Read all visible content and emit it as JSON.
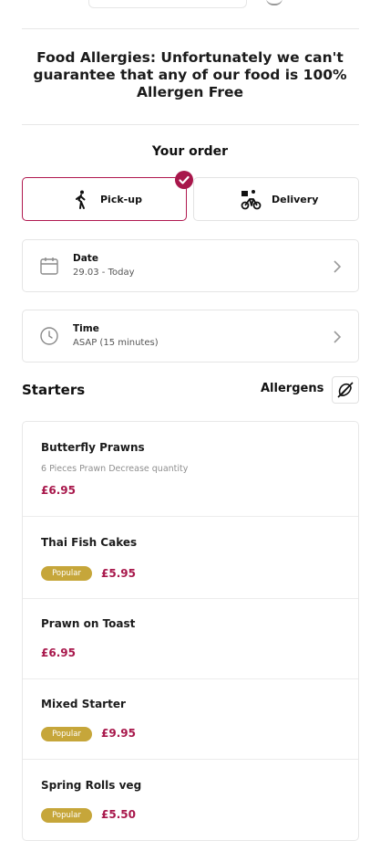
{
  "notice": {
    "allergy_text": "Food Allergies: Unfortunately we can't guarantee that any of our food is 100% Allergen Free"
  },
  "order": {
    "heading": "Your order",
    "options": [
      {
        "label": "Pick-up",
        "selected": true,
        "icon": "walking-person-icon"
      },
      {
        "label": "Delivery",
        "selected": false,
        "icon": "delivery-bike-icon"
      }
    ],
    "date": {
      "label": "Date",
      "value": "29.03 - Today",
      "icon": "calendar-icon"
    },
    "time": {
      "label": "Time",
      "value": "ASAP (15 minutes)",
      "icon": "clock-icon"
    }
  },
  "menu": {
    "section_title": "Starters",
    "allergens_label": "Allergens",
    "items": [
      {
        "name": "Butterfly Prawns",
        "description": "6 Pieces Prawn Decrease quantity",
        "price": "£6.95",
        "badge": ""
      },
      {
        "name": "Thai Fish Cakes",
        "description": "",
        "price": "£5.95",
        "badge": "Popular"
      },
      {
        "name": "Prawn on Toast",
        "description": "",
        "price": "£6.95",
        "badge": ""
      },
      {
        "name": "Mixed Starter",
        "description": "",
        "price": "£9.95",
        "badge": "Popular"
      },
      {
        "name": "Spring Rolls veg",
        "description": "",
        "price": "£5.50",
        "badge": "Popular"
      }
    ]
  },
  "colors": {
    "accent": "#a8174b",
    "badge": "#c6a63a",
    "border": "#e5e5e5"
  }
}
